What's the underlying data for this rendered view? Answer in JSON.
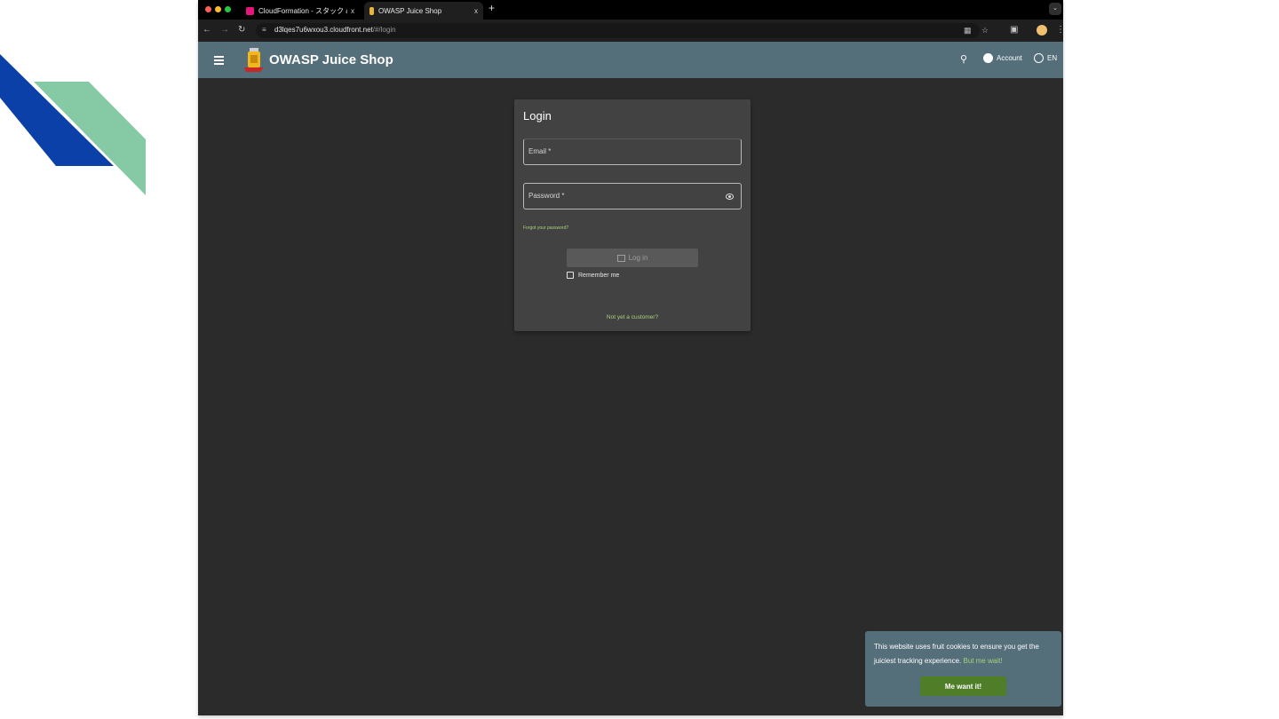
{
  "browser": {
    "tabs": [
      {
        "title": "CloudFormation - スタック an",
        "active": false
      },
      {
        "title": "OWASP Juice Shop",
        "active": true
      }
    ],
    "new_tab": "+",
    "tab_close": "x",
    "url_host": "d3lqes7u6wxou3.cloudfront.net",
    "url_path": "/#/login"
  },
  "toolbar": {
    "brand": "OWASP Juice Shop",
    "account_label": "Account",
    "language_label": "EN"
  },
  "login": {
    "title": "Login",
    "email_label": "Email *",
    "password_label": "Password *",
    "forgot_link": "Forgot your password?",
    "login_button": "Log in",
    "remember_label": "Remember me",
    "register_link": "Not yet a customer?"
  },
  "cookie": {
    "message": "This website uses fruit cookies to ensure you get the juiciest tracking experience.",
    "more_link": "But me wait!",
    "accept_button": "Me want it!"
  },
  "colors": {
    "toolbar": "#546e7a",
    "page_bg": "#2b2b2b",
    "card_bg": "#424242",
    "accent_link": "#a6d27a",
    "cookie_button": "#4f7d28",
    "deco_blue": "#0a40a8",
    "deco_green": "#86c9a5"
  }
}
